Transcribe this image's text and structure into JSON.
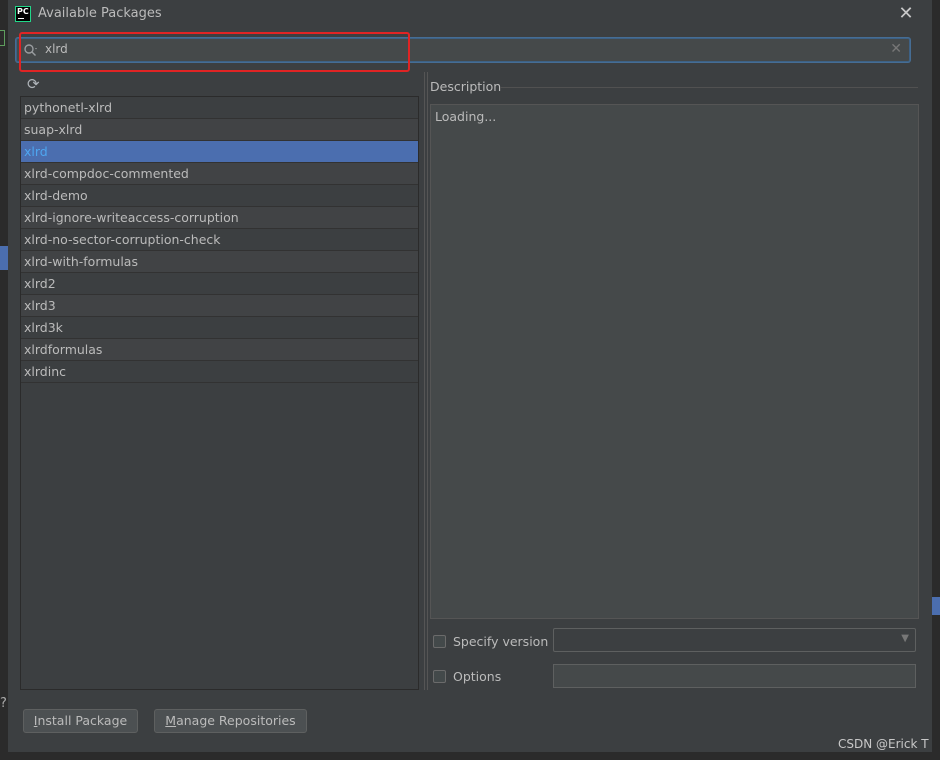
{
  "dialog": {
    "title": "Available Packages",
    "app_icon_text": "PC"
  },
  "search": {
    "value": "xlrd"
  },
  "packages": [
    {
      "name": "pythonetl-xlrd"
    },
    {
      "name": "suap-xlrd"
    },
    {
      "name": "xlrd",
      "selected": true
    },
    {
      "name": "xlrd-compdoc-commented"
    },
    {
      "name": "xlrd-demo"
    },
    {
      "name": "xlrd-ignore-writeaccess-corruption"
    },
    {
      "name": "xlrd-no-sector-corruption-check"
    },
    {
      "name": "xlrd-with-formulas"
    },
    {
      "name": "xlrd2"
    },
    {
      "name": "xlrd3"
    },
    {
      "name": "xlrd3k"
    },
    {
      "name": "xlrdformulas"
    },
    {
      "name": "xlrdinc"
    }
  ],
  "description": {
    "label": "Description",
    "text": "Loading..."
  },
  "options": {
    "specify_version_label": "Specify version",
    "specify_version_checked": false,
    "version_value": "",
    "options_label": "Options",
    "options_checked": false,
    "options_value": ""
  },
  "buttons": {
    "install": "Install Package",
    "manage": "Manage Repositories"
  },
  "watermark": "CSDN @Erick T",
  "colors": {
    "background": "#3c3f41",
    "selection": "#4b6eaf",
    "highlight_box": "#e02424",
    "focus_border": "#466d94"
  },
  "icons": [
    "pycharm-app-icon",
    "close-icon",
    "search-icon",
    "clear-icon",
    "refresh-icon",
    "chevron-down-icon"
  ]
}
